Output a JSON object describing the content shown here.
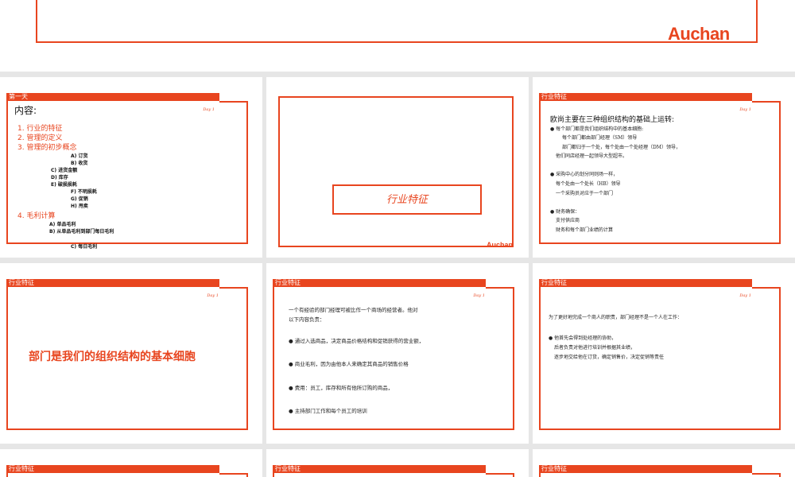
{
  "top": {
    "logo": "Auchan"
  },
  "s1": {
    "header": "第一天",
    "day": "Day 1",
    "title": "内容:",
    "items": [
      "1.  行业的特征",
      "2.  管理的定义",
      "3.  管理的初步概念"
    ],
    "subs": [
      "A) 订货",
      "B) 收货",
      "C) 进货金额",
      "D) 库存",
      "E) 破损损耗",
      "F) 不明损耗",
      "G) 促销",
      "H) 甩卖"
    ],
    "item4": "4.  毛利计算",
    "subs2": [
      "A) 单品毛利",
      "B) 从单品毛利到部门每日毛利",
      "C) 每日毛利"
    ]
  },
  "s2": {
    "title": "行业特征",
    "logo": "Auchan"
  },
  "s3": {
    "header": "行业特征",
    "day": "Day 1",
    "title": "欧尚主要在三种组织结构的基础上运转:",
    "lines": [
      "● 每个部门都是我们组织结构中的基本细胞:",
      "每个部门都由部门经理（SM）领导",
      "部门都归于一个处，每个处由一个处经理（DM）领导，",
      "他们同店经理一起领导大型超市。",
      "● 采购中心的划分同则场一样，",
      "每个处由一个处长（HB）领导",
      "一个采购员对应于一个部门",
      "● 财务确保：",
      "支付供应商",
      "财务和每个部门业绩的计算"
    ]
  },
  "s4": {
    "header": "行业特征",
    "day": "Day 1",
    "text": "部门是我们的组织结构的基本细胞"
  },
  "s5": {
    "header": "行业特征",
    "day": "Day 1",
    "intro1": "一个有经验的部门经理可被比作一个商场的经营者。他对",
    "intro2": "以下内容负责：",
    "bullets": [
      "●  通过入选商品，决定商品价格结构和促销获得的营业额，",
      "●  商业毛利，因为由他本人来确定其商品的销售价格",
      "●  费用：员工，库存和所有他所订购的商品，",
      "●  主持部门工作和每个员工的培训"
    ]
  },
  "s6": {
    "header": "行业特征",
    "day": "Day 1",
    "intro": "为了更好地完成一个商人的职责，部门经理不是一个人在工作：",
    "lines": [
      "●  他首先会得到处经理的协助，",
      "后者负责对他进行培训并根据其业绩，",
      "逐步地交给他在订货，确定销售价，决定促销等责任"
    ]
  },
  "s7": {
    "header": "行业特征"
  },
  "s8": {
    "header": "行业特征"
  },
  "s9": {
    "header": "行业特征"
  }
}
